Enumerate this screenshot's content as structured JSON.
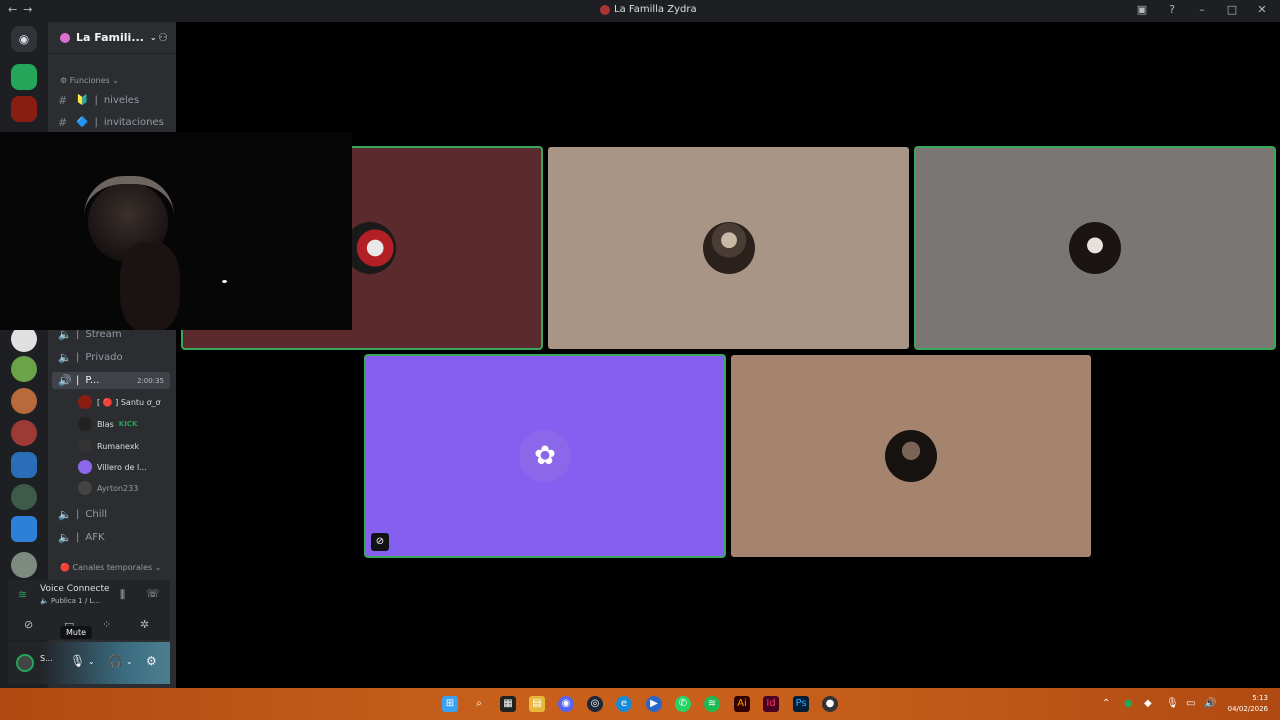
{
  "window": {
    "title": "La Familla Zydra"
  },
  "guild": {
    "name": "La Famili..."
  },
  "sidebar": {
    "categories": {
      "functions": "Funciones",
      "temp": "Canales temporales"
    },
    "text_channels": [
      {
        "emoji": "🔰",
        "name": "niveles"
      },
      {
        "emoji": "🔷",
        "name": "invitaciones"
      }
    ],
    "voice_channels": [
      {
        "name": "Stream"
      },
      {
        "name": "Privado"
      },
      {
        "name": "P...",
        "time": "2:00:35"
      },
      {
        "name": "Chill"
      },
      {
        "name": "AFK"
      }
    ],
    "users": [
      {
        "name": "[ 🔴 ] Santu ơ_ơ"
      },
      {
        "name": "Blas",
        "badge": "KICK"
      },
      {
        "name": "Rumanexk"
      },
      {
        "name": "Villero de l..."
      },
      {
        "name": "Ayrton233"
      }
    ]
  },
  "voice": {
    "status": "Voice Connecte",
    "channel": "Publica 1 / L..."
  },
  "tooltip": {
    "text": "Mute"
  },
  "userpanel": {
    "name": "S..."
  },
  "clock": {
    "time": "5:13",
    "date": "04/02/2026"
  }
}
